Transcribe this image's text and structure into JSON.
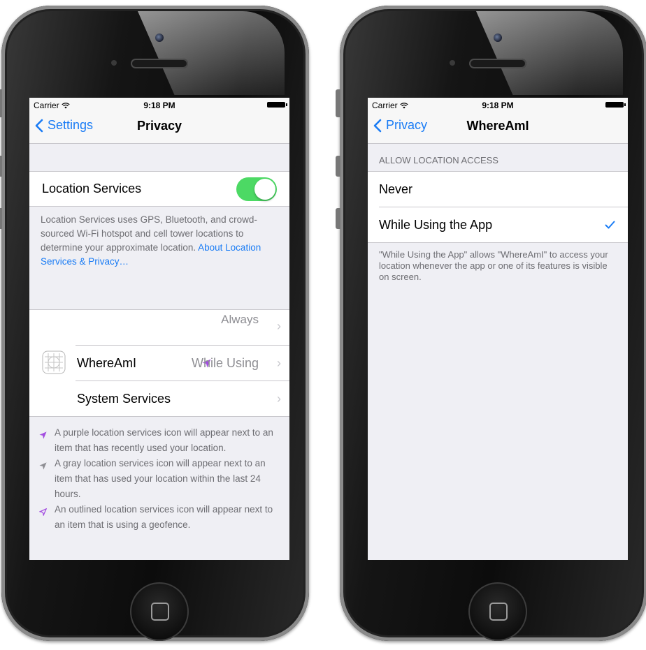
{
  "left_screen": {
    "status": {
      "carrier": "Carrier",
      "time": "9:18 PM"
    },
    "nav": {
      "back_label": "Settings",
      "title": "Privacy"
    },
    "location_services": {
      "label": "Location Services",
      "enabled": true,
      "description": "Location Services uses GPS, Bluetooth, and crowd-sourced Wi-Fi hotspot and cell tower locations to determine your approximate location.",
      "link": "About Location Services & Privacy…"
    },
    "apps": {
      "partial_value": "Always",
      "items": [
        {
          "label": "WhereAmI",
          "value": "While Using"
        },
        {
          "label": "System Services"
        }
      ]
    },
    "notes": [
      {
        "text": "A purple location services icon will appear next to an item that has recently used your location.",
        "icon_color": "#a34ee0"
      },
      {
        "text": "A gray location services icon will appear next to an item that has used your location within the last 24 hours.",
        "icon_color": "#8e8e93"
      },
      {
        "text": "An outlined location services icon will appear next to an item that is using a geofence.",
        "icon_color": "#a34ee0"
      }
    ]
  },
  "right_screen": {
    "status": {
      "carrier": "Carrier",
      "time": "9:18 PM"
    },
    "nav": {
      "back_label": "Privacy",
      "title": "WhereAmI"
    },
    "section_header": "ALLOW LOCATION ACCESS",
    "options": [
      {
        "label": "Never",
        "selected": false
      },
      {
        "label": "While Using the App",
        "selected": true
      }
    ],
    "footer": "\"While Using the App\" allows \"WhereAmI\" to access your location whenever the app or one of its features is visible on screen."
  },
  "colors": {
    "accent": "#1a7cf5",
    "toggle_on": "#4cd964",
    "location_purple": "#a34ee0"
  }
}
